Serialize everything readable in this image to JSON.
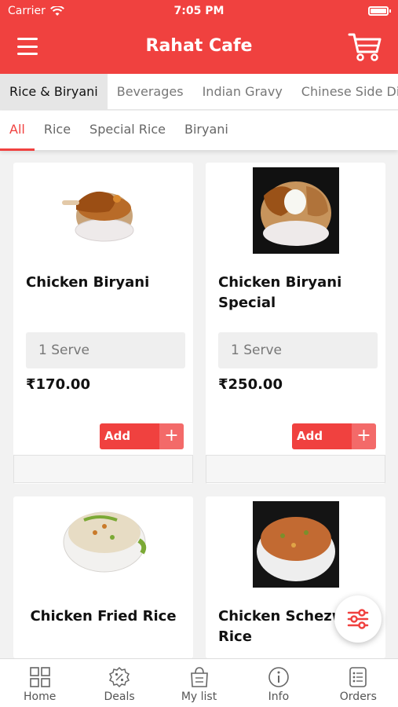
{
  "status": {
    "carrier": "Carrier",
    "time": "7:05 PM"
  },
  "header": {
    "title": "Rahat Cafe"
  },
  "categories": [
    {
      "label": "Rice & Biryani"
    },
    {
      "label": "Beverages"
    },
    {
      "label": "Indian Gravy"
    },
    {
      "label": "Chinese Side Dish"
    }
  ],
  "subcategories": [
    {
      "label": "All"
    },
    {
      "label": "Rice"
    },
    {
      "label": "Special Rice"
    },
    {
      "label": "Biryani"
    }
  ],
  "products": [
    {
      "name": "Chicken Biryani",
      "serve": "1 Serve",
      "price": "₹170.00",
      "add": "Add"
    },
    {
      "name": "Chicken Biryani Special",
      "serve": "1 Serve",
      "price": "₹250.00",
      "add": "Add"
    },
    {
      "name": "Chicken Fried Rice"
    },
    {
      "name": "Chicken Schezwan Rice"
    }
  ],
  "bottom_nav": [
    {
      "label": "Home",
      "icon": "grid-icon"
    },
    {
      "label": "Deals",
      "icon": "discount-badge-icon"
    },
    {
      "label": "My list",
      "icon": "shopping-bag-icon"
    },
    {
      "label": "Info",
      "icon": "info-icon"
    },
    {
      "label": "Orders",
      "icon": "orders-list-icon"
    }
  ],
  "colors": {
    "accent": "#f0413f"
  }
}
